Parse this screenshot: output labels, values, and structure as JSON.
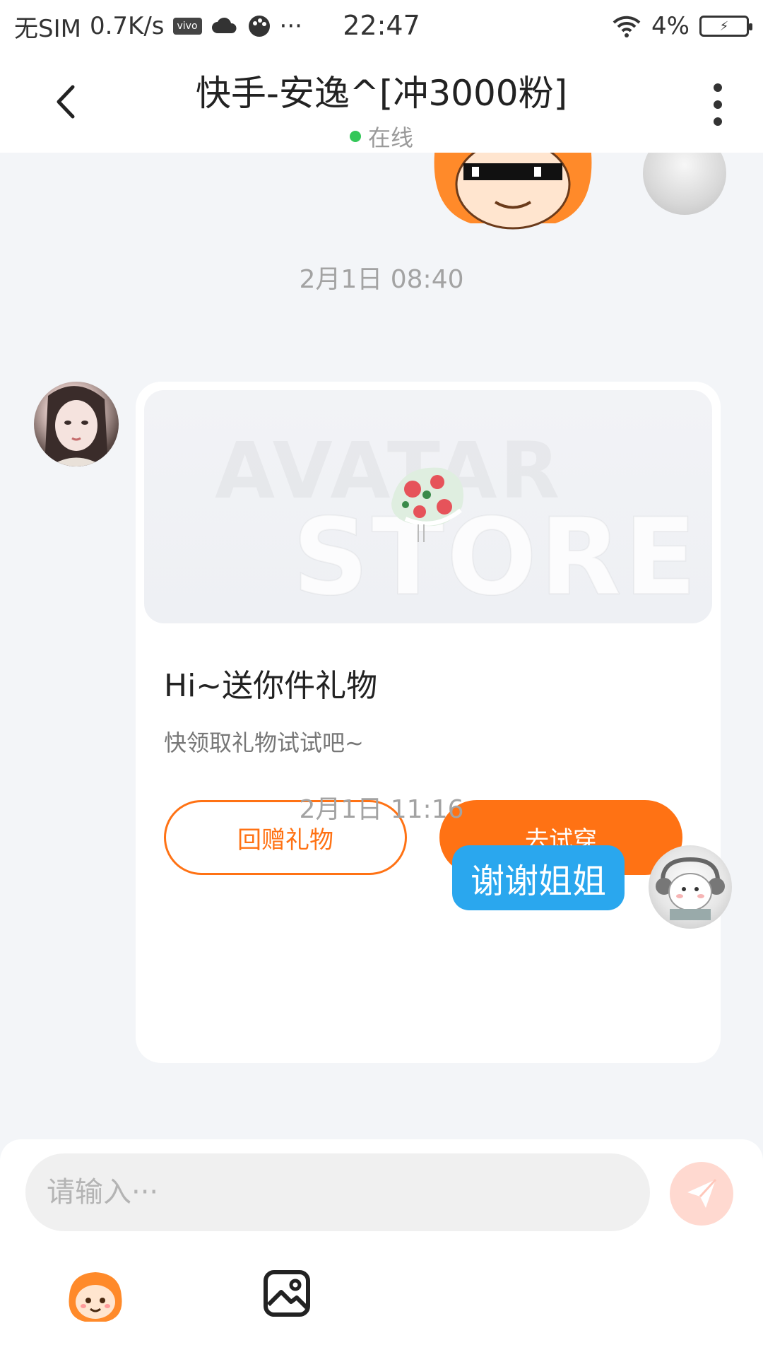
{
  "status_bar": {
    "sim": "无SIM",
    "speed": "0.7K/s",
    "carrier_badge": "vivo",
    "more": "···",
    "time": "22:47",
    "battery": "4%",
    "icons": [
      "vivo-badge",
      "cloud-icon",
      "palette-icon",
      "wifi-icon",
      "battery-icon"
    ]
  },
  "header": {
    "title": "快手-安逸^[冲3000粉]",
    "status": "在线",
    "online_color": "#34c759"
  },
  "chat": {
    "timestamp_1": "2月1日 08:40",
    "gift_card": {
      "watermark_1": "AVATAR",
      "watermark_2": "STORE",
      "title": "Hi~送你件礼物",
      "subtitle": "快领取礼物试试吧~",
      "btn_return_gift": "回赠礼物",
      "btn_try_on": "去试穿",
      "accent_color": "#ff7214"
    },
    "timestamp_2": "2月1日 11:16",
    "my_message": "谢谢姐姐",
    "bubble_color": "#2aa7ee"
  },
  "composer": {
    "placeholder": "请输入···",
    "icons": [
      "send-icon",
      "kuaishou-emoji-icon",
      "image-icon"
    ]
  }
}
